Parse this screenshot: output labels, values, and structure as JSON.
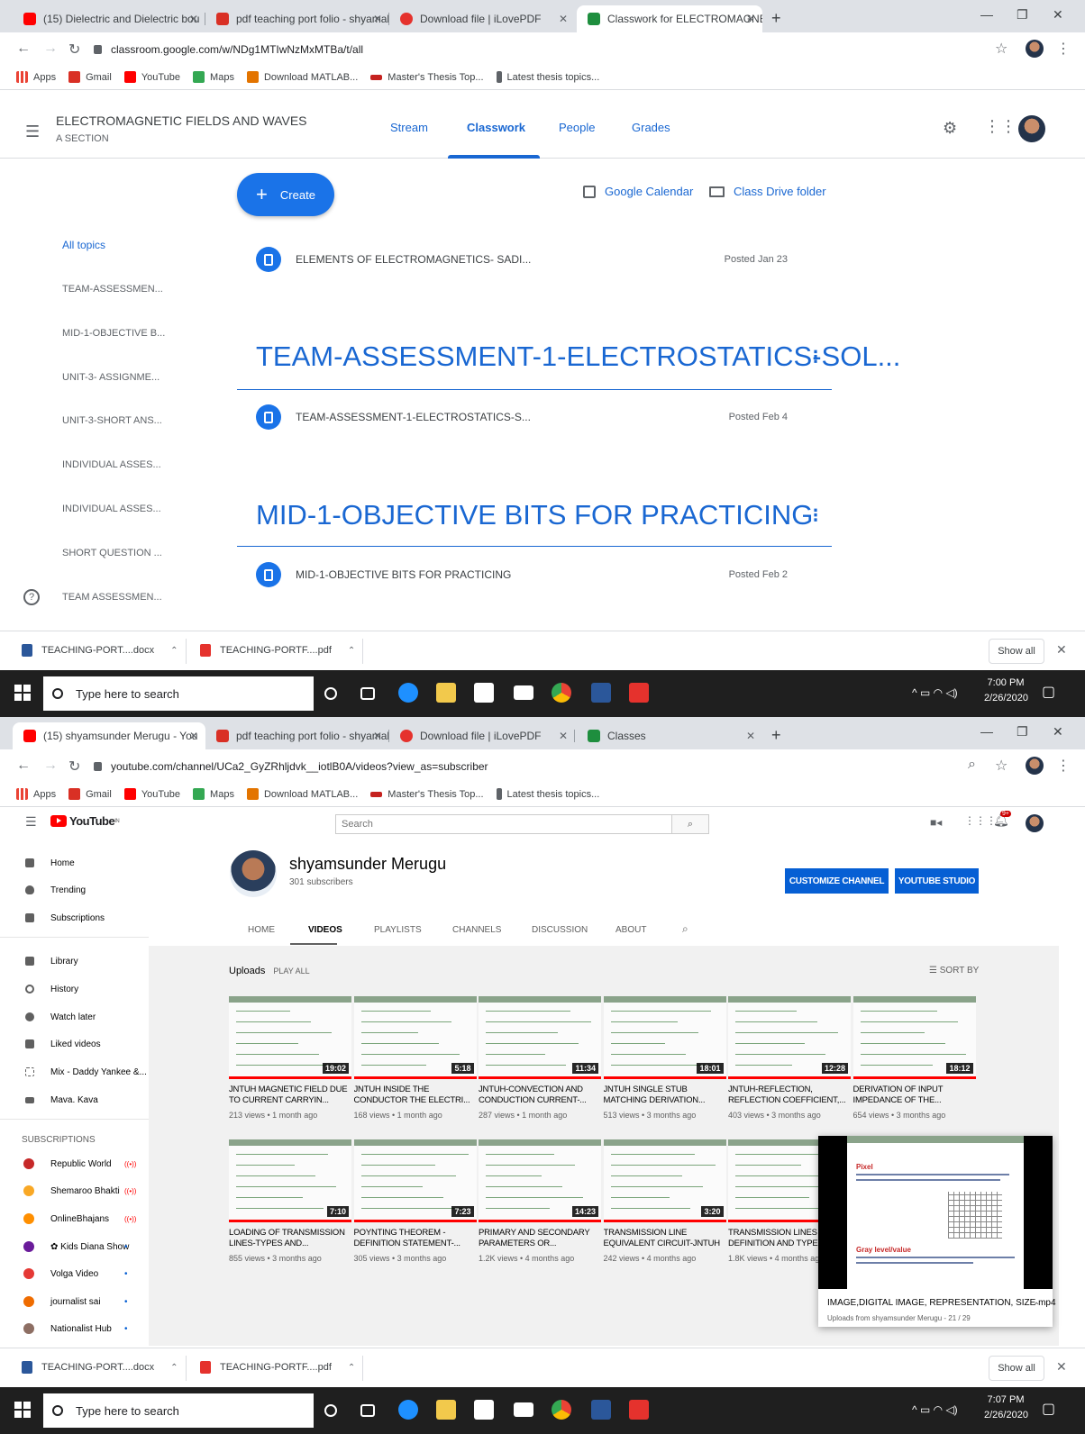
{
  "screen1": {
    "tabs": [
      {
        "title": "(15) Dielectric and Dielectric bou",
        "color": "#ff0000"
      },
      {
        "title": "pdf teaching port folio - shyamal",
        "color": "#d93025"
      },
      {
        "title": "Download file | iLovePDF",
        "color": "#e5322d"
      },
      {
        "title": "Classwork for ELECTROMAGNETI",
        "color": "#1e8e3e"
      }
    ],
    "url": "classroom.google.com/w/NDg1MTIwNzMxMTBa/t/all",
    "bookmarks": [
      "Apps",
      "Gmail",
      "YouTube",
      "Maps",
      "Download MATLAB...",
      "Master's Thesis Top...",
      "Latest thesis topics..."
    ],
    "classroom": {
      "class_title": "ELECTROMAGNETIC FIELDS AND WAVES",
      "section": "A SECTION",
      "nav_tabs": [
        "Stream",
        "Classwork",
        "People",
        "Grades"
      ],
      "create_label": "Create",
      "calendar_link": "Google Calendar",
      "drive_link": "Class Drive folder",
      "topics_nav": [
        "All topics",
        "TEAM-ASSESSMEN...",
        "MID-1-OBJECTIVE B...",
        "UNIT-3- ASSIGNME...",
        "UNIT-3-SHORT ANS...",
        "INDIVIDUAL ASSES...",
        "INDIVIDUAL ASSES...",
        "SHORT QUESTION ...",
        "TEAM ASSESSMEN..."
      ],
      "help_glyph": "?",
      "items": [
        {
          "title": "ELEMENTS OF ELECTROMAGNETICS- SADI...",
          "date": "Posted Jan 23"
        },
        {
          "title": "TEAM-ASSESSMENT-1-ELECTROSTATICS-S...",
          "date": "Posted Feb 4"
        },
        {
          "title": "MID-1-OBJECTIVE BITS FOR PRACTICING",
          "date": "Posted Feb 2"
        }
      ],
      "topic_headers": [
        "TEAM-ASSESSMENT-1-ELECTROSTATICS-SOL...",
        "MID-1-OBJECTIVE BITS FOR PRACTICING"
      ]
    },
    "downloads": [
      "TEACHING-PORT....docx",
      "TEACHING-PORTF....pdf"
    ],
    "show_all": "Show all",
    "taskbar_search": "Type here to search",
    "time": "7:00 PM",
    "date": "2/26/2020"
  },
  "screen2": {
    "tabs": [
      {
        "title": "(15) shyamsunder Merugu - You",
        "color": "#ff0000"
      },
      {
        "title": "pdf teaching port folio - shyamal",
        "color": "#d93025"
      },
      {
        "title": "Download file | iLovePDF",
        "color": "#e5322d"
      },
      {
        "title": "Classes",
        "color": "#1e8e3e"
      }
    ],
    "url": "youtube.com/channel/UCa2_GyZRhljdvk__iotlB0A/videos?view_as=subscriber",
    "youtube": {
      "logo": "YouTube",
      "country": "IN",
      "search_placeholder": "Search",
      "notification_count": "9+",
      "sidebar": [
        "Home",
        "Trending",
        "Subscriptions",
        "Library",
        "History",
        "Watch later",
        "Liked videos",
        "Mix - Daddy Yankee &...",
        "Mava. Kava"
      ],
      "subscriptions_heading": "SUBSCRIPTIONS",
      "subscriptions": [
        "Republic World",
        "Shemaroo Bhakti",
        "OnlineBhajans",
        "✿ Kids Diana Show",
        "Volga Video",
        "journalist sai",
        "Nationalist Hub"
      ],
      "channel_name": "shyamsunder Merugu",
      "subscribers": "301 subscribers",
      "customize_btn": "CUSTOMIZE CHANNEL",
      "studio_btn": "YOUTUBE STUDIO",
      "channel_tabs": [
        "HOME",
        "VIDEOS",
        "PLAYLISTS",
        "CHANNELS",
        "DISCUSSION",
        "ABOUT"
      ],
      "uploads_label": "Uploads",
      "play_all": "PLAY ALL",
      "sort_by": "SORT BY",
      "videos": [
        {
          "title": "JNTUH MAGNETIC FIELD DUE TO CURRENT CARRYIN...",
          "meta": "213 views • 1 month ago",
          "duration": "19:02"
        },
        {
          "title": "JNTUH INSIDE THE CONDUCTOR THE ELECTRI...",
          "meta": "168 views • 1 month ago",
          "duration": "5:18"
        },
        {
          "title": "JNTUH-CONVECTION AND CONDUCTION CURRENT-...",
          "meta": "287 views • 1 month ago",
          "duration": "11:34"
        },
        {
          "title": "JNTUH SINGLE STUB MATCHING DERIVATION...",
          "meta": "513 views • 3 months ago",
          "duration": "18:01"
        },
        {
          "title": "JNTUH-REFLECTION, REFLECTION COEFFICIENT,...",
          "meta": "403 views • 3 months ago",
          "duration": "12:28"
        },
        {
          "title": "DERIVATION OF INPUT IMPEDANCE OF THE...",
          "meta": "654 views • 3 months ago",
          "duration": "18:12"
        },
        {
          "title": "LOADING OF TRANSMISSION LINES-TYPES AND...",
          "meta": "855 views • 3 months ago",
          "duration": "7:10"
        },
        {
          "title": "POYNTING THEOREM - DEFINITION STATEMENT-...",
          "meta": "305 views • 3 months ago",
          "duration": "7:23"
        },
        {
          "title": "PRIMARY AND SECONDARY PARAMETERS OR...",
          "meta": "1.2K views • 4 months ago",
          "duration": "14:23"
        },
        {
          "title": "TRANSMISSION LINE EQUIVALENT CIRCUIT-JNTUH",
          "meta": "242 views • 4 months ago",
          "duration": "3:20"
        },
        {
          "title": "TRANSMISSION LINES - DEFINITION AND TYPES",
          "meta": "1.8K views • 4 months ago",
          "duration": ""
        }
      ],
      "miniplayer": {
        "title": "IMAGE,DIGITAL IMAGE, REPRESENTATION, SIZE mp4",
        "subtitle": "Uploads from shyamsunder Merugu - 21 / 29",
        "slide_heading1": "Pixel",
        "slide_heading2": "Gray level/value"
      }
    },
    "downloads": [
      "TEACHING-PORT....docx",
      "TEACHING-PORTF....pdf"
    ],
    "show_all": "Show all",
    "taskbar_search": "Type here to search",
    "time": "7:07 PM",
    "date": "2/26/2020"
  },
  "colors": {
    "classroom_blue": "#1967d2",
    "youtube_red": "#ff0000",
    "youtube_blue": "#065fd4",
    "taskbar": "#1f1f1f"
  }
}
